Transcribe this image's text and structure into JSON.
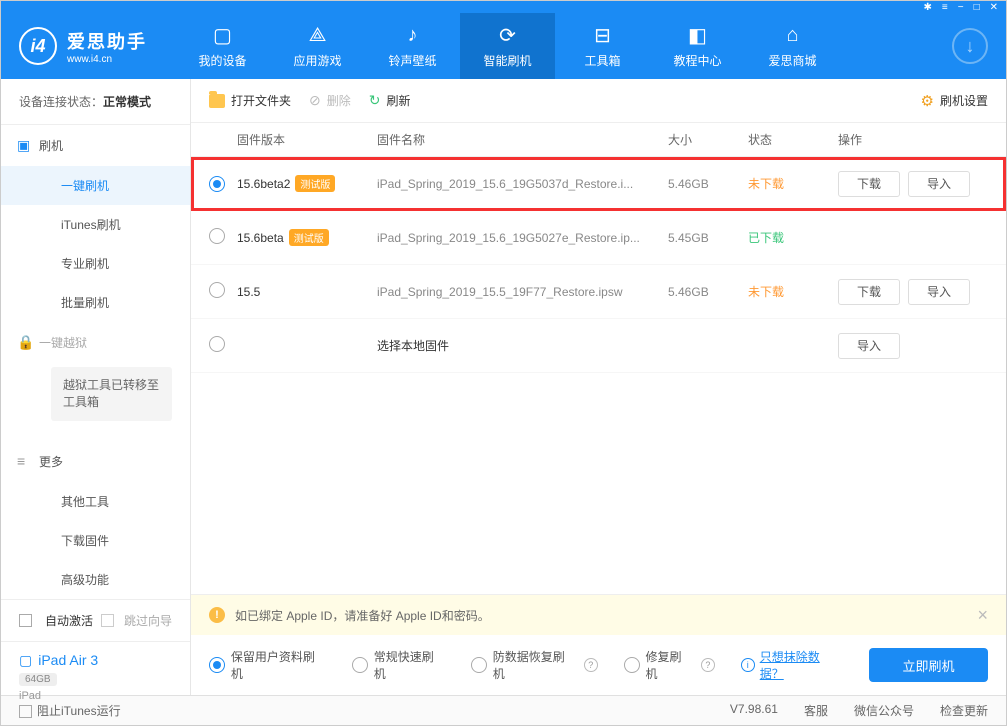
{
  "titlebar_icons": [
    "✱",
    "≡",
    "−",
    "□",
    "✕"
  ],
  "logo": {
    "title": "爱思助手",
    "url": "www.i4.cn"
  },
  "nav": [
    {
      "label": "我的设备",
      "icon": "▢"
    },
    {
      "label": "应用游戏",
      "icon": "⟁"
    },
    {
      "label": "铃声壁纸",
      "icon": "♪"
    },
    {
      "label": "智能刷机",
      "icon": "⟳"
    },
    {
      "label": "工具箱",
      "icon": "⊟"
    },
    {
      "label": "教程中心",
      "icon": "◧"
    },
    {
      "label": "爱思商城",
      "icon": "⌂"
    }
  ],
  "sidebar": {
    "status_label": "设备连接状态：",
    "status_value": "正常模式",
    "groups": {
      "flash": {
        "header": "刷机",
        "items": [
          "一键刷机",
          "iTunes刷机",
          "专业刷机",
          "批量刷机"
        ]
      },
      "jailbreak": {
        "header": "一键越狱",
        "note": "越狱工具已转移至工具箱"
      },
      "more": {
        "header": "更多",
        "items": [
          "其他工具",
          "下载固件",
          "高级功能"
        ]
      }
    },
    "auto_activate": "自动激活",
    "skip_wizard": "跳过向导",
    "device": {
      "name": "iPad Air 3",
      "storage": "64GB",
      "type": "iPad"
    }
  },
  "toolbar": {
    "open": "打开文件夹",
    "delete": "删除",
    "refresh": "刷新",
    "settings": "刷机设置"
  },
  "columns": {
    "version": "固件版本",
    "name": "固件名称",
    "size": "大小",
    "status": "状态",
    "action": "操作"
  },
  "firmware": [
    {
      "version": "15.6beta2",
      "beta": true,
      "name": "iPad_Spring_2019_15.6_19G5037d_Restore.i...",
      "size": "5.46GB",
      "status": "未下载",
      "status_key": "not",
      "download": true,
      "import": true,
      "selected": true,
      "highlight": true
    },
    {
      "version": "15.6beta",
      "beta": true,
      "name": "iPad_Spring_2019_15.6_19G5027e_Restore.ip...",
      "size": "5.45GB",
      "status": "已下载",
      "status_key": "done",
      "download": false,
      "import": false,
      "selected": false
    },
    {
      "version": "15.5",
      "beta": false,
      "name": "iPad_Spring_2019_15.5_19F77_Restore.ipsw",
      "size": "5.46GB",
      "status": "未下载",
      "status_key": "not",
      "download": true,
      "import": true,
      "selected": false
    },
    {
      "version": "",
      "beta": false,
      "name": "选择本地固件",
      "size": "",
      "status": "",
      "status_key": "",
      "download": false,
      "import": true,
      "selected": false,
      "local": true
    }
  ],
  "beta_label": "测试版",
  "actions": {
    "download": "下载",
    "import": "导入"
  },
  "alert": "如已绑定 Apple ID，请准备好 Apple ID和密码。",
  "flash_options": [
    {
      "label": "保留用户资料刷机",
      "checked": true
    },
    {
      "label": "常规快速刷机",
      "checked": false
    },
    {
      "label": "防数据恢复刷机",
      "checked": false,
      "help": true
    },
    {
      "label": "修复刷机",
      "checked": false,
      "help": true
    }
  ],
  "erase_info": "只想抹除数据？",
  "flash_now": "立即刷机",
  "statusbar": {
    "block_itunes": "阻止iTunes运行",
    "version": "V7.98.61",
    "items": [
      "客服",
      "微信公众号",
      "检查更新"
    ]
  }
}
